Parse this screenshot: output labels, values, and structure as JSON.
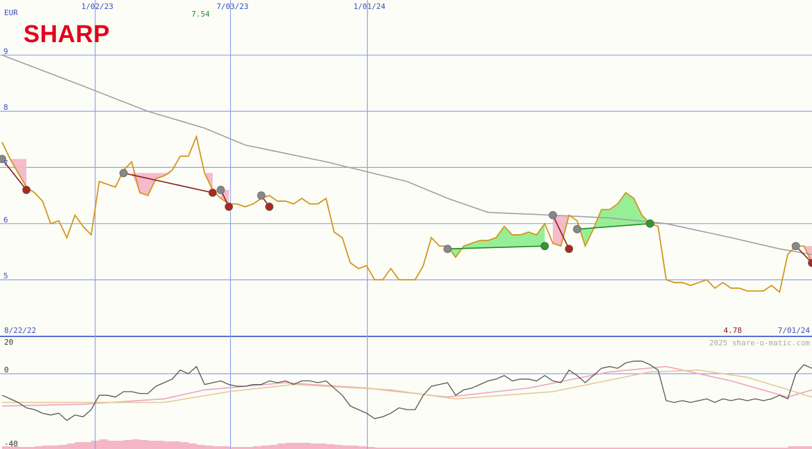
{
  "logo": {
    "text": "SHARP",
    "color": "#e3001b"
  },
  "currency": "EUR",
  "watermark": "2025 share-o-matic.com",
  "price_panel": {
    "high_label": "7.54",
    "low_label": "4.78",
    "start_date": "8/22/22",
    "end_date": "7/01/24",
    "x_ticks": [
      "1/02/23",
      "7/03/23",
      "1/01/24"
    ],
    "y_ticks": [
      "9",
      "8",
      "7",
      "6",
      "5"
    ]
  },
  "osc_panel": {
    "y_ticks": [
      "20",
      "0",
      "-40"
    ]
  },
  "colors": {
    "price": "#d4951c",
    "moving_average": "#a0a0a0",
    "grid": "#8ea2ea",
    "up_fill": "#90ee90",
    "down_fill": "#f4b6c8",
    "up_marker": "#2e9a2e",
    "down_marker": "#b0281c",
    "start_marker": "#888888",
    "oscillator": "#555555",
    "signal_pink": "#f2a0c0",
    "signal_tan": "#e6c898",
    "volume": "#f4b6c8"
  },
  "chart_data": [
    {
      "type": "line",
      "ylim": [
        4,
        9.5
      ],
      "x_index_range": [
        0,
        100
      ],
      "series": [
        {
          "kind": "price",
          "values": [
            7.45,
            7.15,
            6.9,
            6.65,
            6.55,
            6.4,
            6.0,
            6.05,
            5.75,
            6.15,
            5.95,
            5.8,
            6.75,
            6.7,
            6.65,
            6.95,
            7.1,
            6.55,
            6.5,
            6.8,
            6.85,
            6.95,
            7.2,
            7.2,
            7.55,
            6.9,
            6.6,
            6.45,
            6.35,
            6.35,
            6.3,
            6.35,
            6.45,
            6.5,
            6.4,
            6.4,
            6.35,
            6.45,
            6.35,
            6.35,
            6.45,
            5.85,
            5.75,
            5.3,
            5.2,
            5.25,
            5.0,
            5.0,
            5.2,
            5.0,
            5.0,
            5.0,
            5.25,
            5.75,
            5.6,
            5.6,
            5.4,
            5.6,
            5.65,
            5.7,
            5.7,
            5.75,
            5.95,
            5.8,
            5.8,
            5.85,
            5.8,
            6.0,
            5.65,
            5.6,
            6.15,
            6.05,
            5.6,
            5.9,
            6.25,
            6.25,
            6.35,
            6.55,
            6.45,
            6.15,
            6.0,
            5.95,
            5.0,
            4.95,
            4.95,
            4.9,
            4.95,
            5.0,
            4.85,
            4.95,
            4.85,
            4.85,
            4.8,
            4.8,
            4.8,
            4.9,
            4.78,
            5.45,
            5.6,
            5.6,
            5.3
          ]
        },
        {
          "kind": "moving_average",
          "points": [
            [
              0,
              9.0
            ],
            [
              10,
              8.45
            ],
            [
              18,
              8.0
            ],
            [
              25,
              7.7
            ],
            [
              30,
              7.4
            ],
            [
              40,
              7.1
            ],
            [
              50,
              6.75
            ],
            [
              55,
              6.45
            ],
            [
              60,
              6.2
            ],
            [
              68,
              6.15
            ],
            [
              75,
              6.1
            ],
            [
              82,
              6.0
            ],
            [
              90,
              5.75
            ],
            [
              96,
              5.55
            ],
            [
              100,
              5.45
            ]
          ]
        }
      ],
      "signals": [
        {
          "kind": "down",
          "start": [
            0,
            7.15
          ],
          "end": [
            3,
            6.6
          ]
        },
        {
          "kind": "down",
          "start": [
            15,
            6.9
          ],
          "end": [
            26,
            6.55
          ]
        },
        {
          "kind": "down",
          "start": [
            27,
            6.6
          ],
          "end": [
            28,
            6.3
          ]
        },
        {
          "kind": "down",
          "start": [
            32,
            6.5
          ],
          "end": [
            33,
            6.3
          ]
        },
        {
          "kind": "up",
          "start": [
            55,
            5.55
          ],
          "end": [
            67,
            5.6
          ]
        },
        {
          "kind": "down",
          "start": [
            68,
            6.15
          ],
          "end": [
            70,
            5.55
          ]
        },
        {
          "kind": "up",
          "start": [
            71,
            5.9
          ],
          "end": [
            80,
            6.0
          ]
        },
        {
          "kind": "down",
          "start": [
            98,
            5.6
          ],
          "end": [
            100,
            5.3
          ]
        }
      ]
    },
    {
      "type": "line",
      "ylim": [
        -40,
        23
      ],
      "series": [
        {
          "kind": "oscillator",
          "values": [
            -12,
            -14,
            -16,
            -19,
            -20,
            -22,
            -23,
            -22,
            -26,
            -23,
            -24,
            -20,
            -12,
            -12,
            -13,
            -10,
            -10,
            -11,
            -11,
            -7,
            -5,
            -3,
            2,
            0,
            4,
            -6,
            -5,
            -4,
            -6,
            -7,
            -7,
            -6,
            -6,
            -4,
            -5,
            -4,
            -6,
            -4,
            -4,
            -5,
            -4,
            -8,
            -12,
            -18,
            -20,
            -22,
            -25,
            -24,
            -22,
            -19,
            -20,
            -20,
            -12,
            -7,
            -6,
            -5,
            -12,
            -9,
            -8,
            -6,
            -4,
            -3,
            -1,
            -4,
            -3,
            -3,
            -4,
            -1,
            -4,
            -5,
            2,
            -1,
            -5,
            -1,
            3,
            4,
            3,
            6,
            7,
            7,
            5,
            2,
            -15,
            -16,
            -15,
            -16,
            -15,
            -14,
            -16,
            -14,
            -15,
            -14,
            -15,
            -14,
            -15,
            -14,
            -12,
            -14,
            0,
            5,
            3,
            0,
            -1
          ]
        },
        {
          "kind": "signal_pink",
          "points": [
            [
              0,
              -18
            ],
            [
              10,
              -17
            ],
            [
              20,
              -14
            ],
            [
              25,
              -9
            ],
            [
              35,
              -5
            ],
            [
              45,
              -8
            ],
            [
              55,
              -13
            ],
            [
              65,
              -8
            ],
            [
              75,
              1
            ],
            [
              82,
              4
            ],
            [
              90,
              -4
            ],
            [
              97,
              -13
            ],
            [
              100,
              -9
            ]
          ]
        },
        {
          "kind": "signal_tan",
          "points": [
            [
              0,
              -16
            ],
            [
              10,
              -16
            ],
            [
              20,
              -16
            ],
            [
              28,
              -10
            ],
            [
              36,
              -6
            ],
            [
              48,
              -9
            ],
            [
              56,
              -14
            ],
            [
              68,
              -10
            ],
            [
              80,
              1
            ],
            [
              86,
              2
            ],
            [
              92,
              -2
            ],
            [
              100,
              -13
            ]
          ]
        }
      ]
    }
  ]
}
